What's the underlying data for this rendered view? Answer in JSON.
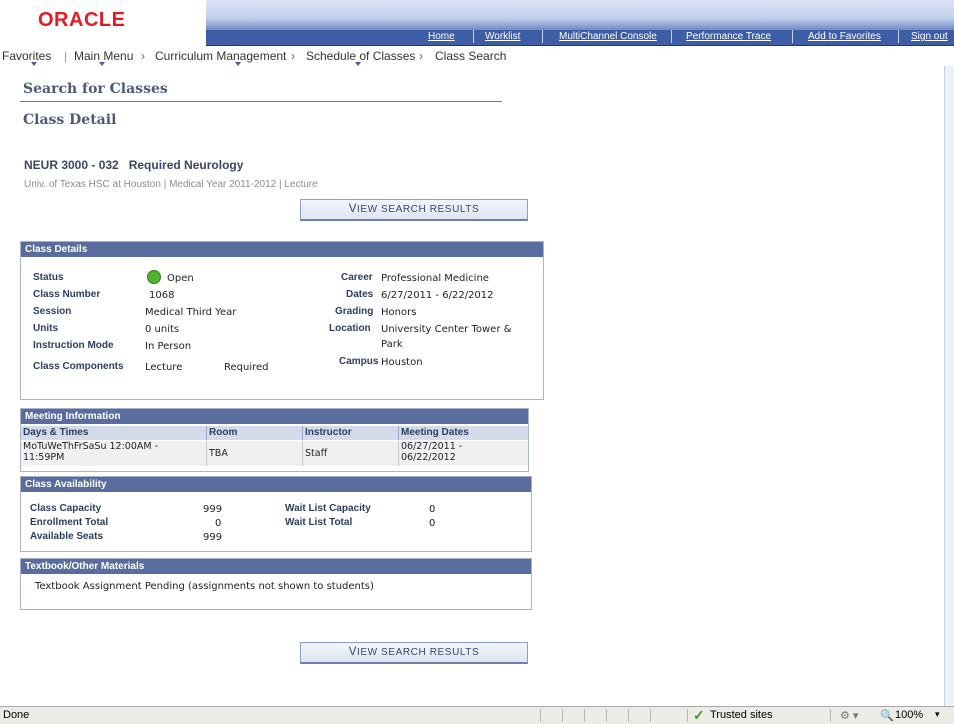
{
  "header": {
    "logo": "ORACLE",
    "links": [
      "Home",
      "Worklist",
      "MultiChannel Console",
      "Performance Trace",
      "Add to Favorites",
      "Sign out"
    ]
  },
  "breadcrumb": [
    "Favorites",
    "Main Menu",
    "Curriculum Management",
    "Schedule of Classes",
    "Class Search"
  ],
  "page": {
    "search_title": "Search for Classes",
    "detail_title": "Class Detail",
    "course_title": "NEUR 3000 - 032   Required Neurology",
    "course_sub": "Univ. of Texas HSC at Houston | Medical Year 2011-2012 | Lecture",
    "view_results_first": "V",
    "view_results_rest": "IEW SEARCH RESULTS"
  },
  "class_details": {
    "header": "Class Details",
    "status_label": "Status",
    "status_value": "Open",
    "class_number_label": "Class Number",
    "class_number_value": "1068",
    "session_label": "Session",
    "session_value": "Medical Third Year",
    "units_label": "Units",
    "units_value": "0 units",
    "instruction_mode_label": "Instruction Mode",
    "instruction_mode_value": "In Person",
    "components_label": "Class Components",
    "components_value": "Lecture",
    "components_req": "Required",
    "career_label": "Career",
    "career_value": "Professional Medicine",
    "dates_label": "Dates",
    "dates_value": "6/27/2011 - 6/22/2012",
    "grading_label": "Grading",
    "grading_value": "Honors",
    "location_label": "Location",
    "location_value_1": "University Center Tower &",
    "location_value_2": "Park",
    "campus_label": "Campus",
    "campus_value": "Houston",
    "status_color": "#4fb32f"
  },
  "meeting": {
    "header": "Meeting Information",
    "columns": [
      "Days & Times",
      "Room",
      "Instructor",
      "Meeting Dates"
    ],
    "row": {
      "days_1": "MoTuWeThFrSaSu 12:00AM -",
      "days_2": "11:59PM",
      "room": "TBA",
      "instructor": "Staff",
      "dates_1": "06/27/2011 -",
      "dates_2": "06/22/2012"
    }
  },
  "availability": {
    "header": "Class Availability",
    "capacity_label": "Class Capacity",
    "capacity_value": "999",
    "enrollment_label": "Enrollment Total",
    "enrollment_value": "0",
    "available_label": "Available Seats",
    "available_value": "999",
    "wl_capacity_label": "Wait List Capacity",
    "wl_capacity_value": "0",
    "wl_total_label": "Wait List Total",
    "wl_total_value": "0"
  },
  "textbook": {
    "header": "Textbook/Other Materials",
    "text": "Textbook Assignment Pending  (assignments not shown to students)"
  },
  "statusbar": {
    "status": "Done",
    "zone": "Trusted sites",
    "zoom": "100%"
  }
}
